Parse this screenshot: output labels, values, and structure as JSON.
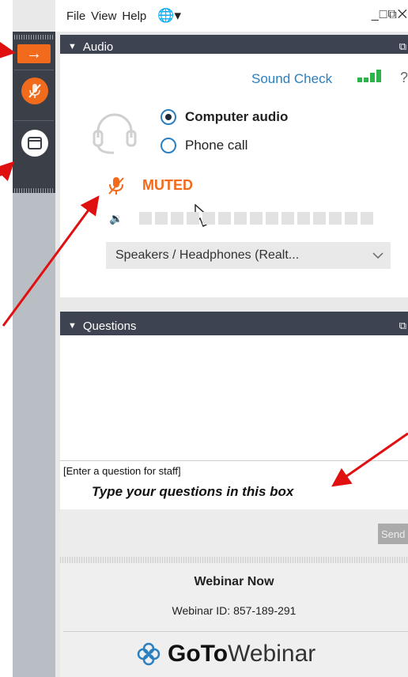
{
  "menu": {
    "items": [
      "File",
      "View",
      "Help"
    ],
    "window_controls": "_□⧉✕"
  },
  "audio": {
    "header": "Audio",
    "sound_check": "Sound Check",
    "help": "?",
    "options": [
      {
        "label": "Computer audio",
        "selected": true
      },
      {
        "label": "Phone call",
        "selected": false
      }
    ],
    "status": "MUTED",
    "device": "Speakers / Headphones (Realt..."
  },
  "questions": {
    "header": "Questions",
    "input_placeholder": "[Enter a question for staff]",
    "hint": "Type your questions in this box",
    "send_label": "Send"
  },
  "footer": {
    "title": "Webinar Now",
    "webinar_id": "Webinar ID: 857-189-291",
    "brand_bold": "GoTo",
    "brand_light": "Webinar"
  },
  "colors": {
    "accent": "#f26b1d",
    "link": "#2a7fc0",
    "signal": "#2cb34a",
    "arrow": "#e01010",
    "header_bg": "#3d4350"
  }
}
